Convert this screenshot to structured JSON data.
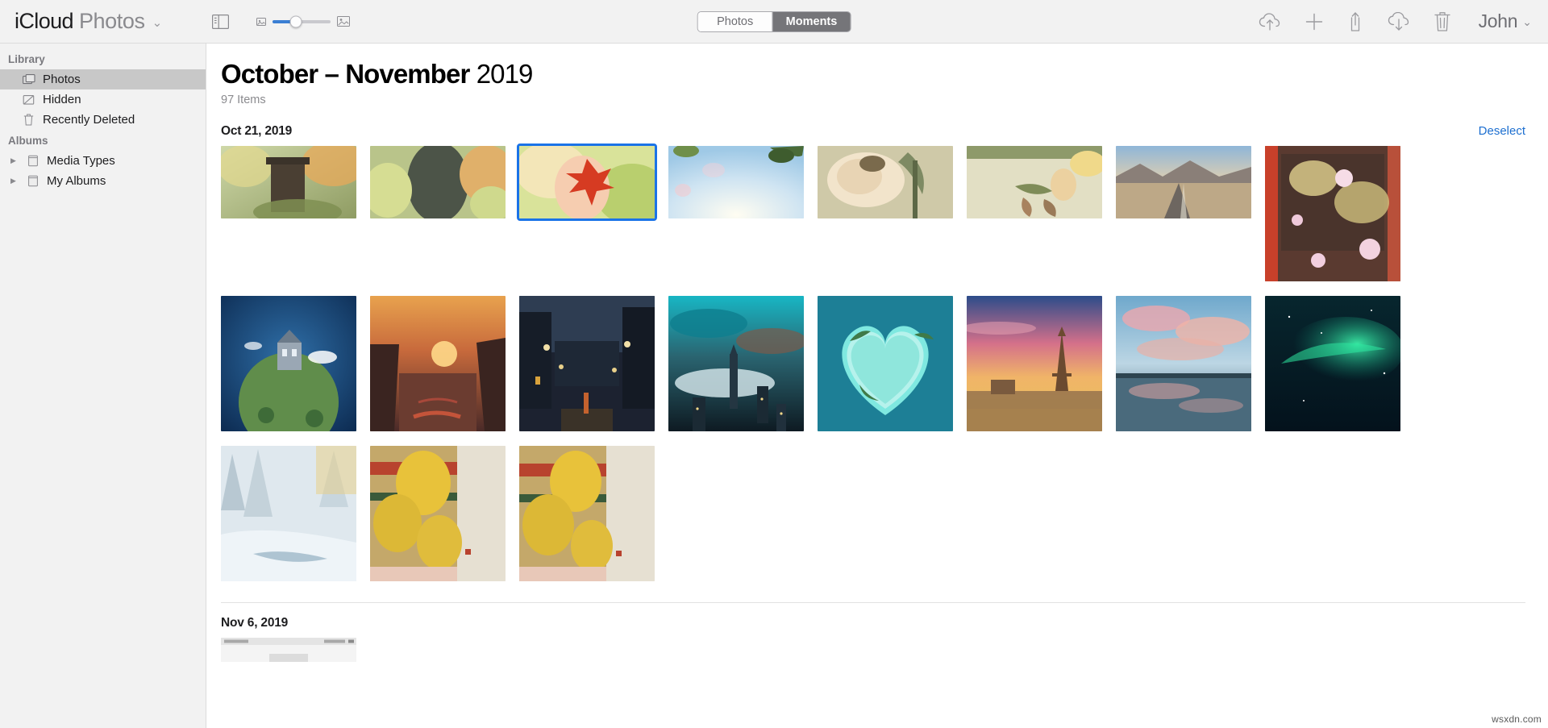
{
  "toolbar": {
    "brand_primary": "iCloud",
    "brand_secondary": "Photos",
    "brand_caret": "⌄",
    "sidebar_toggle_icon": "sidebar-toggle-icon",
    "zoom_small_icon": "small-thumbnail-icon",
    "zoom_large_icon": "large-thumbnail-icon",
    "zoom_value": 40,
    "segments": [
      {
        "label": "Photos",
        "active": false
      },
      {
        "label": "Moments",
        "active": true
      }
    ],
    "actions": [
      {
        "name": "upload-button",
        "icon": "cloud-upload-icon"
      },
      {
        "name": "add-button",
        "icon": "plus-icon"
      },
      {
        "name": "share-button",
        "icon": "share-icon"
      },
      {
        "name": "download-button",
        "icon": "cloud-download-icon"
      },
      {
        "name": "delete-button",
        "icon": "trash-icon"
      }
    ],
    "account_name": "John",
    "account_caret": "⌄"
  },
  "sidebar": {
    "sections": [
      {
        "title": "Library",
        "items": [
          {
            "label": "Photos",
            "icon": "photos-icon",
            "selected": true,
            "twisty": false
          },
          {
            "label": "Hidden",
            "icon": "hidden-icon",
            "selected": false,
            "twisty": false
          },
          {
            "label": "Recently Deleted",
            "icon": "trash-icon",
            "selected": false,
            "twisty": false
          }
        ]
      },
      {
        "title": "Albums",
        "items": [
          {
            "label": "Media Types",
            "icon": "album-icon",
            "selected": false,
            "twisty": true
          },
          {
            "label": "My Albums",
            "icon": "album-icon",
            "selected": false,
            "twisty": true
          }
        ]
      }
    ]
  },
  "main": {
    "title_bold": "October – November",
    "title_year": "2019",
    "item_count": "97 Items",
    "moments": [
      {
        "date": "Oct 21, 2019",
        "deselect_label": "Deselect",
        "photos": [
          {
            "name": "photo-wooden-shrine-autumn",
            "selected": false,
            "tall": false
          },
          {
            "name": "photo-tree-trunk-maple-leaves",
            "selected": false,
            "tall": false
          },
          {
            "name": "photo-red-maple-leaf-in-hand",
            "selected": true,
            "tall": false
          },
          {
            "name": "photo-blue-sky-sun-flare",
            "selected": false,
            "tall": false
          },
          {
            "name": "photo-withered-cream-rose",
            "selected": false,
            "tall": false
          },
          {
            "name": "photo-yellow-rose-buds",
            "selected": false,
            "tall": false
          },
          {
            "name": "photo-desert-highway-mountains",
            "selected": false,
            "tall": false
          },
          {
            "name": "photo-cherry-blossom-red-wall",
            "selected": false,
            "tall": true
          },
          {
            "name": "photo-tiny-planet-castle",
            "selected": false,
            "tall": true
          },
          {
            "name": "photo-sunset-palm-street",
            "selected": false,
            "tall": true
          },
          {
            "name": "photo-night-city-street-lights",
            "selected": false,
            "tall": true
          },
          {
            "name": "photo-teal-city-skyline-dusk",
            "selected": false,
            "tall": true
          },
          {
            "name": "photo-heart-shaped-island-lagoon",
            "selected": false,
            "tall": true
          },
          {
            "name": "photo-eiffel-tower-sunset",
            "selected": false,
            "tall": true
          },
          {
            "name": "photo-pink-cloud-lake-reflection",
            "selected": false,
            "tall": true
          },
          {
            "name": "photo-aurora-borealis-green",
            "selected": false,
            "tall": true
          },
          {
            "name": "photo-snow-winter-forest-river",
            "selected": false,
            "tall": true
          },
          {
            "name": "photo-ginkgo-temple-gold-a",
            "selected": false,
            "tall": true
          },
          {
            "name": "photo-ginkgo-temple-gold-b",
            "selected": false,
            "tall": true
          }
        ]
      },
      {
        "date": "Nov 6, 2019",
        "deselect_label": "",
        "photos": [
          {
            "name": "photo-partial-screenshot",
            "selected": false,
            "tall": false
          }
        ]
      }
    ]
  },
  "watermark": "wsxdn.com",
  "colors": {
    "accent_blue": "#1d6fd0",
    "selection_blue": "#1a73e8",
    "slider_blue": "#3b7fd4",
    "chrome_gray": "#f2f2f2",
    "sidebar_selected": "#c8c8c8"
  }
}
